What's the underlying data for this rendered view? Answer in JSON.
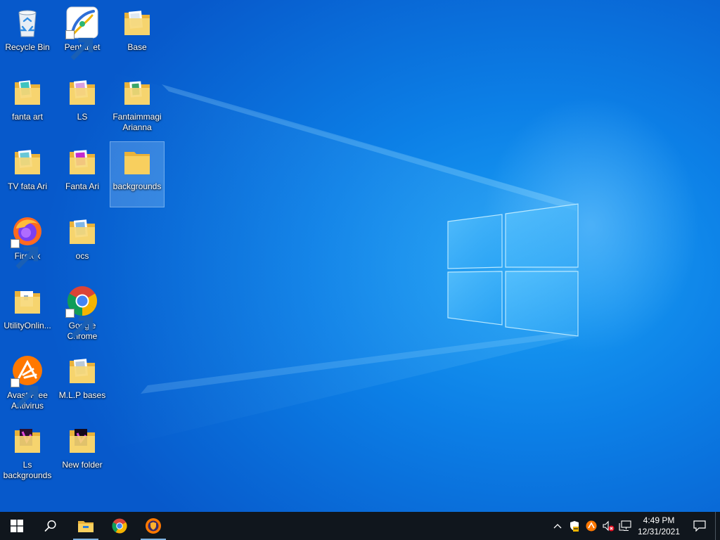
{
  "desktop": {
    "icons": [
      {
        "name": "recycle-bin",
        "label": "Recycle Bin",
        "kind": "recycle"
      },
      {
        "name": "pentablet-shortcut",
        "label": "Pentablet",
        "kind": "app-pentablet",
        "shortcut": true
      },
      {
        "name": "folder-base",
        "label": "Base",
        "kind": "folder-thumb"
      },
      {
        "name": "folder-fanta-art",
        "label": "fanta art",
        "kind": "folder-thumb"
      },
      {
        "name": "folder-ls",
        "label": "LS",
        "kind": "folder-thumb"
      },
      {
        "name": "folder-fantaimmagi-arianna",
        "label": "Fantaimmagi Arianna",
        "kind": "folder-thumb"
      },
      {
        "name": "folder-tv-fata-ari",
        "label": "TV  fata Ari",
        "kind": "folder-thumb"
      },
      {
        "name": "folder-fanta-ari",
        "label": "Fanta Ari",
        "kind": "folder-thumb-pink"
      },
      {
        "name": "folder-backgrounds",
        "label": "backgrounds",
        "kind": "folder",
        "selected": true
      },
      {
        "name": "firefox-shortcut",
        "label": "Firefox",
        "kind": "app-firefox",
        "shortcut": true
      },
      {
        "name": "folder-ocs",
        "label": "ocs",
        "kind": "folder-thumb"
      },
      {
        "name": "folder-utilityonline",
        "label": "UtilityOnlin...",
        "kind": "folder-doc"
      },
      {
        "name": "chrome-shortcut",
        "label": "Google Chrome",
        "kind": "app-chrome",
        "shortcut": true
      },
      {
        "name": "avast-shortcut",
        "label": "Avast Free Antivirus",
        "kind": "app-avast",
        "shortcut": true
      },
      {
        "name": "folder-mlp-bases",
        "label": "M.L.P bases",
        "kind": "folder-thumb"
      },
      {
        "name": "folder-ls-backgrounds",
        "label": "Ls backgrounds",
        "kind": "folder-thumb-dark"
      },
      {
        "name": "folder-new-folder",
        "label": "New folder",
        "kind": "folder-thumb-dark"
      }
    ]
  },
  "taskbar": {
    "pinned": [
      {
        "name": "start-button",
        "icon": "windows-logo-icon"
      },
      {
        "name": "search-button",
        "icon": "search-icon"
      },
      {
        "name": "file-explorer-button",
        "icon": "folder-icon",
        "running": true
      },
      {
        "name": "chrome-taskbar-button",
        "icon": "chrome-icon"
      },
      {
        "name": "avast-secure-browser-button",
        "icon": "avast-browser-icon",
        "running": true
      }
    ],
    "tray": [
      {
        "name": "show-hidden-icons-button",
        "icon": "chevron-up-icon"
      },
      {
        "name": "windows-security-tray-icon",
        "icon": "shield-icon"
      },
      {
        "name": "avast-tray-icon",
        "icon": "avast-icon"
      },
      {
        "name": "volume-tray-icon",
        "icon": "speaker-muted-icon"
      },
      {
        "name": "network-tray-icon",
        "icon": "network-icon"
      }
    ],
    "clock": {
      "time": "4:49 PM",
      "date": "12/31/2021"
    },
    "notification_icon": "action-center-icon"
  },
  "colors": {
    "taskbar": "#10161d",
    "accent": "#0078d7",
    "folder": "#f7c44e"
  }
}
